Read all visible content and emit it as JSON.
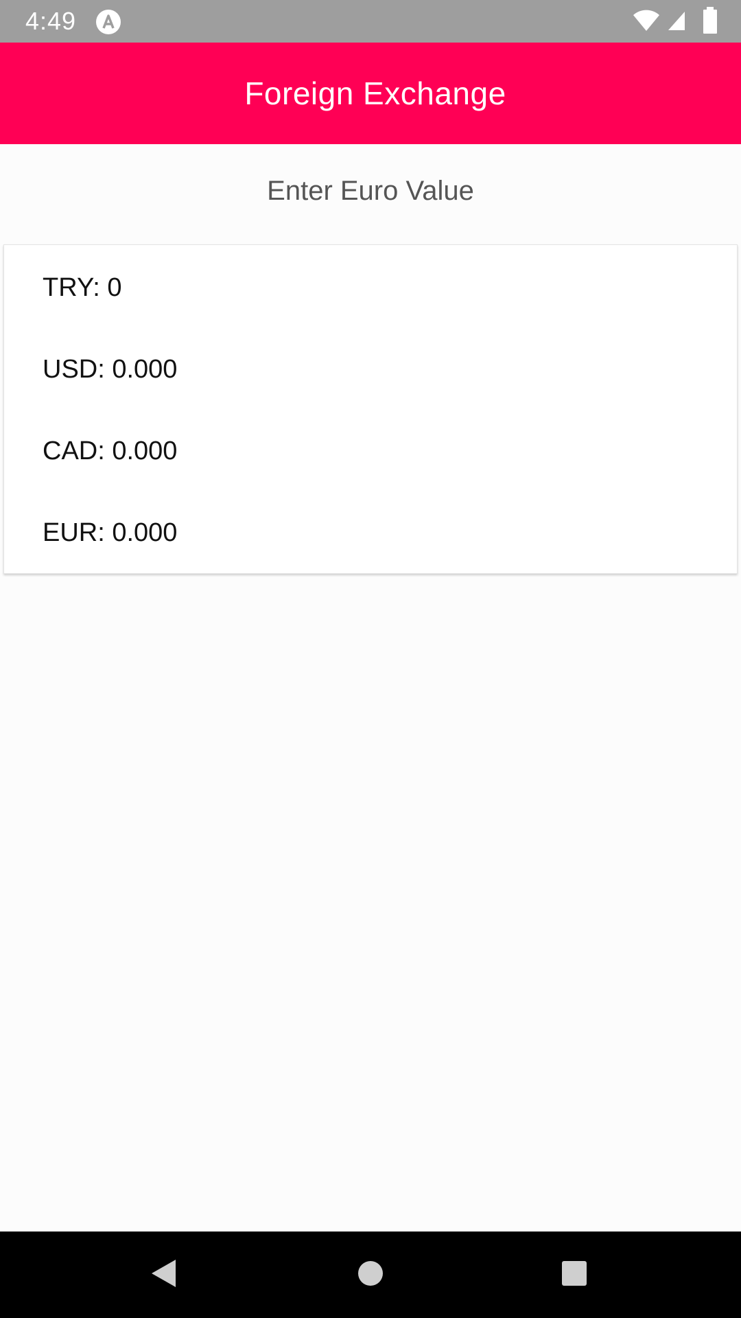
{
  "status_bar": {
    "time": "4:49",
    "icons": [
      "app-notification-icon",
      "wifi-icon",
      "signal-icon",
      "battery-icon"
    ]
  },
  "app_bar": {
    "title": "Foreign Exchange",
    "color": "#ff0055"
  },
  "euro_input": {
    "placeholder": "Enter Euro Value",
    "value": ""
  },
  "rates": [
    {
      "label": "TRY: 0"
    },
    {
      "label": "USD: 0.000"
    },
    {
      "label": "CAD: 0.000"
    },
    {
      "label": "EUR: 0.000"
    }
  ],
  "nav_bar": {
    "buttons": [
      "back-icon",
      "home-icon",
      "recents-icon"
    ]
  }
}
